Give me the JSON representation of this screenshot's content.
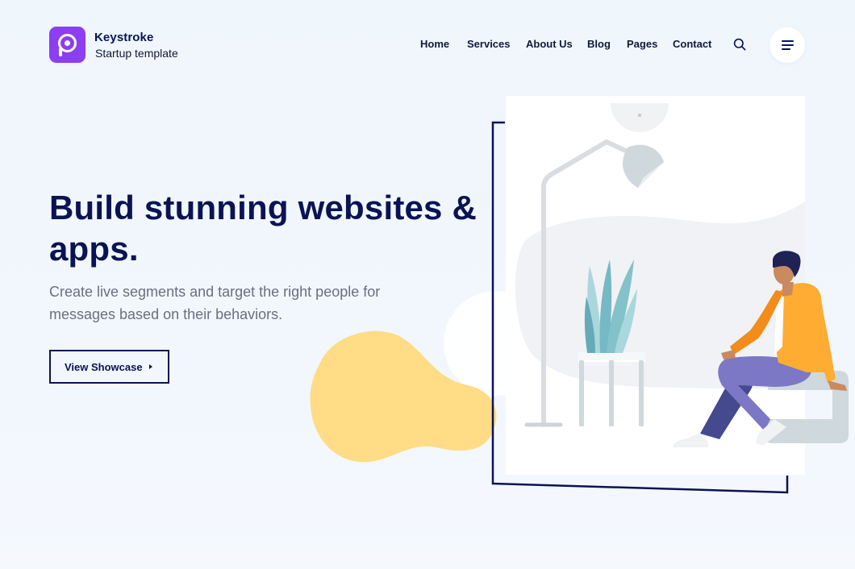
{
  "brand": {
    "name": "Keystroke",
    "tagline": "Startup template"
  },
  "nav": {
    "items": [
      {
        "label": "Home"
      },
      {
        "label": "Services"
      },
      {
        "label": "About Us"
      },
      {
        "label": "Blog"
      },
      {
        "label": "Pages"
      },
      {
        "label": "Contact"
      }
    ]
  },
  "hero": {
    "title_line1": "Build stunning websites &",
    "title_line2": "apps.",
    "subtitle_line1": "Create live segments and target the right people for",
    "subtitle_line2": "messages based on their behaviors.",
    "cta_label": "View Showcase"
  },
  "icons": {
    "search": "search-icon",
    "menu": "hamburger-menu-icon",
    "cta_arrow": "caret-right-icon",
    "logo": "brand-logo-icon"
  },
  "colors": {
    "brand_purple": "#8b3ff0",
    "navy": "#0b1354",
    "blob_yellow": "#ffdc85",
    "jacket_orange": "#ffac33",
    "pants_purple": "#7c78c6",
    "plant_teal": "#7ec0c9"
  }
}
